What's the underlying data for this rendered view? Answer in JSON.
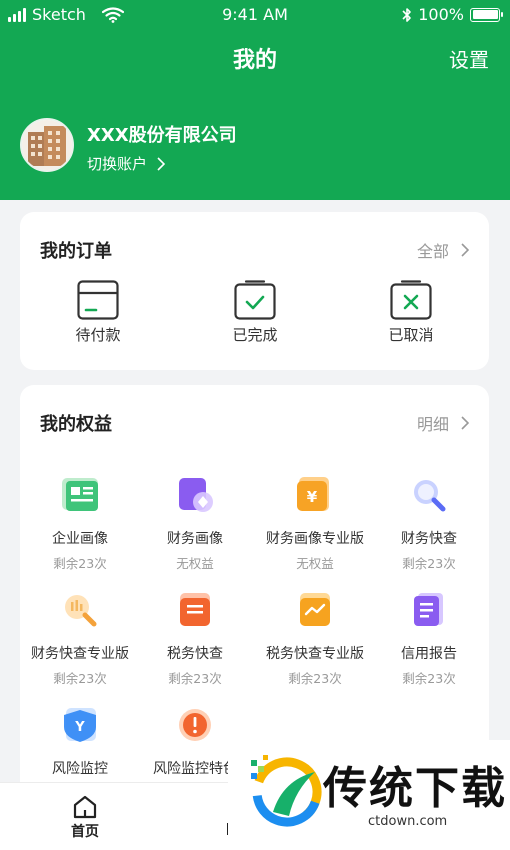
{
  "status_bar": {
    "carrier": "Sketch",
    "time": "9:41 AM",
    "battery": "100%"
  },
  "header": {
    "title": "我的",
    "settings_label": "设置"
  },
  "account": {
    "company_name": "XXX股份有限公司",
    "switch_label": "切换账户"
  },
  "orders": {
    "title": "我的订单",
    "all_label": "全部",
    "items": [
      {
        "label": "待付款",
        "icon": "pending-payment-icon"
      },
      {
        "label": "已完成",
        "icon": "completed-icon"
      },
      {
        "label": "已取消",
        "icon": "cancelled-icon"
      }
    ]
  },
  "benefits": {
    "title": "我的权益",
    "detail_label": "明细",
    "items": [
      {
        "name": "企业画像",
        "sub": "剩余23次",
        "icon": "enterprise-profile-icon",
        "color": "#3fc47a"
      },
      {
        "name": "财务画像",
        "sub": "无权益",
        "icon": "finance-profile-icon",
        "color": "#8a5cf0"
      },
      {
        "name": "财务画像专业版",
        "sub": "无权益",
        "icon": "finance-pro-icon",
        "color": "#f7a325"
      },
      {
        "name": "财务快查",
        "sub": "剩余23次",
        "icon": "finance-quick-check-icon",
        "color": "#5b6cf5"
      },
      {
        "name": "财务快查专业版",
        "sub": "剩余23次",
        "icon": "finance-quick-pro-icon",
        "color": "#f4b860"
      },
      {
        "name": "税务快查",
        "sub": "剩余23次",
        "icon": "tax-quick-check-icon",
        "color": "#f2652f"
      },
      {
        "name": "税务快查专业版",
        "sub": "剩余23次",
        "icon": "tax-quick-pro-icon",
        "color": "#f6a31f"
      },
      {
        "name": "信用报告",
        "sub": "剩余23次",
        "icon": "credit-report-icon",
        "color": "#8a5cf0"
      },
      {
        "name": "风险监控",
        "sub": "",
        "icon": "risk-monitor-icon",
        "color": "#2f86f5"
      },
      {
        "name": "风险监控特色",
        "sub": "",
        "icon": "risk-feature-icon",
        "color": "#f2652f"
      }
    ]
  },
  "tabbar": {
    "home_label": "首页"
  },
  "watermark": {
    "text": "传统下载",
    "url": "ctdown.com"
  },
  "colors": {
    "brand_green": "#13a853",
    "page_bg": "#f2f3f5"
  }
}
